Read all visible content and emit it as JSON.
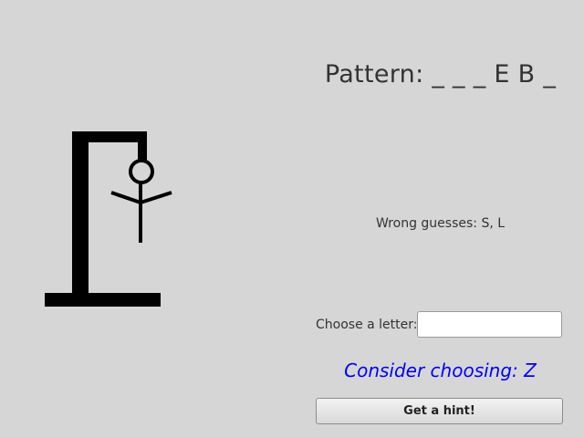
{
  "game": {
    "pattern_label": "Pattern: _ _ _ E B _",
    "wrong_guesses_label": "Wrong guesses: S, L",
    "choose_letter_label": "Choose a letter:",
    "letter_input_value": "",
    "suggestion_text": "Consider choosing: Z",
    "hint_button_label": "Get a hint!",
    "wrong_guess_count": 2,
    "hangman_parts_drawn": [
      "head",
      "arms",
      "body"
    ]
  },
  "colors": {
    "background": "#d6d6d6",
    "text": "#333333",
    "suggestion": "#0000ff",
    "drawing": "#000000"
  }
}
